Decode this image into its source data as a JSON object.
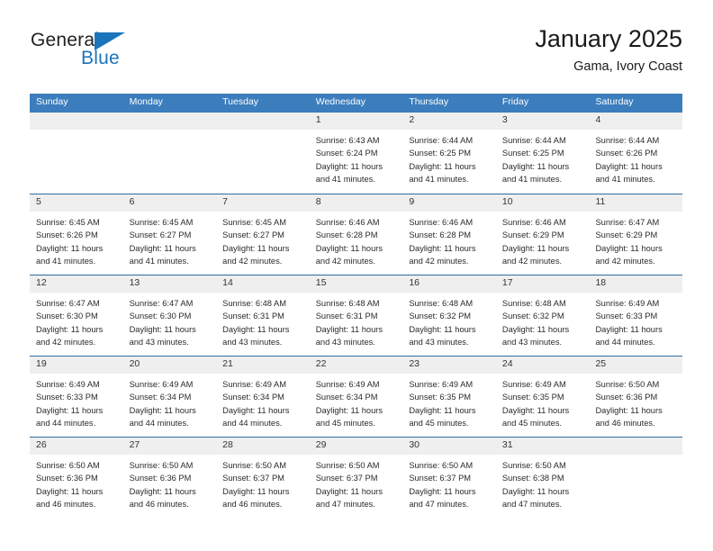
{
  "brand": {
    "name_part1": "General",
    "name_part2": "Blue",
    "colors": {
      "blue": "#1b75bb",
      "dark": "#231f20"
    }
  },
  "header": {
    "title": "January 2025",
    "subtitle": "Gama, Ivory Coast"
  },
  "calendar": {
    "accent_color": "#3b7dbd",
    "row_divider_color": "#2e6da4",
    "day_band_color": "#efefef",
    "weekday_headers": [
      "Sunday",
      "Monday",
      "Tuesday",
      "Wednesday",
      "Thursday",
      "Friday",
      "Saturday"
    ],
    "weeks": [
      [
        {
          "day": "",
          "empty": true
        },
        {
          "day": "",
          "empty": true
        },
        {
          "day": "",
          "empty": true
        },
        {
          "day": "1",
          "sunrise": "Sunrise: 6:43 AM",
          "sunset": "Sunset: 6:24 PM",
          "daylight": "Daylight: 11 hours and 41 minutes."
        },
        {
          "day": "2",
          "sunrise": "Sunrise: 6:44 AM",
          "sunset": "Sunset: 6:25 PM",
          "daylight": "Daylight: 11 hours and 41 minutes."
        },
        {
          "day": "3",
          "sunrise": "Sunrise: 6:44 AM",
          "sunset": "Sunset: 6:25 PM",
          "daylight": "Daylight: 11 hours and 41 minutes."
        },
        {
          "day": "4",
          "sunrise": "Sunrise: 6:44 AM",
          "sunset": "Sunset: 6:26 PM",
          "daylight": "Daylight: 11 hours and 41 minutes."
        }
      ],
      [
        {
          "day": "5",
          "sunrise": "Sunrise: 6:45 AM",
          "sunset": "Sunset: 6:26 PM",
          "daylight": "Daylight: 11 hours and 41 minutes."
        },
        {
          "day": "6",
          "sunrise": "Sunrise: 6:45 AM",
          "sunset": "Sunset: 6:27 PM",
          "daylight": "Daylight: 11 hours and 41 minutes."
        },
        {
          "day": "7",
          "sunrise": "Sunrise: 6:45 AM",
          "sunset": "Sunset: 6:27 PM",
          "daylight": "Daylight: 11 hours and 42 minutes."
        },
        {
          "day": "8",
          "sunrise": "Sunrise: 6:46 AM",
          "sunset": "Sunset: 6:28 PM",
          "daylight": "Daylight: 11 hours and 42 minutes."
        },
        {
          "day": "9",
          "sunrise": "Sunrise: 6:46 AM",
          "sunset": "Sunset: 6:28 PM",
          "daylight": "Daylight: 11 hours and 42 minutes."
        },
        {
          "day": "10",
          "sunrise": "Sunrise: 6:46 AM",
          "sunset": "Sunset: 6:29 PM",
          "daylight": "Daylight: 11 hours and 42 minutes."
        },
        {
          "day": "11",
          "sunrise": "Sunrise: 6:47 AM",
          "sunset": "Sunset: 6:29 PM",
          "daylight": "Daylight: 11 hours and 42 minutes."
        }
      ],
      [
        {
          "day": "12",
          "sunrise": "Sunrise: 6:47 AM",
          "sunset": "Sunset: 6:30 PM",
          "daylight": "Daylight: 11 hours and 42 minutes."
        },
        {
          "day": "13",
          "sunrise": "Sunrise: 6:47 AM",
          "sunset": "Sunset: 6:30 PM",
          "daylight": "Daylight: 11 hours and 43 minutes."
        },
        {
          "day": "14",
          "sunrise": "Sunrise: 6:48 AM",
          "sunset": "Sunset: 6:31 PM",
          "daylight": "Daylight: 11 hours and 43 minutes."
        },
        {
          "day": "15",
          "sunrise": "Sunrise: 6:48 AM",
          "sunset": "Sunset: 6:31 PM",
          "daylight": "Daylight: 11 hours and 43 minutes."
        },
        {
          "day": "16",
          "sunrise": "Sunrise: 6:48 AM",
          "sunset": "Sunset: 6:32 PM",
          "daylight": "Daylight: 11 hours and 43 minutes."
        },
        {
          "day": "17",
          "sunrise": "Sunrise: 6:48 AM",
          "sunset": "Sunset: 6:32 PM",
          "daylight": "Daylight: 11 hours and 43 minutes."
        },
        {
          "day": "18",
          "sunrise": "Sunrise: 6:49 AM",
          "sunset": "Sunset: 6:33 PM",
          "daylight": "Daylight: 11 hours and 44 minutes."
        }
      ],
      [
        {
          "day": "19",
          "sunrise": "Sunrise: 6:49 AM",
          "sunset": "Sunset: 6:33 PM",
          "daylight": "Daylight: 11 hours and 44 minutes."
        },
        {
          "day": "20",
          "sunrise": "Sunrise: 6:49 AM",
          "sunset": "Sunset: 6:34 PM",
          "daylight": "Daylight: 11 hours and 44 minutes."
        },
        {
          "day": "21",
          "sunrise": "Sunrise: 6:49 AM",
          "sunset": "Sunset: 6:34 PM",
          "daylight": "Daylight: 11 hours and 44 minutes."
        },
        {
          "day": "22",
          "sunrise": "Sunrise: 6:49 AM",
          "sunset": "Sunset: 6:34 PM",
          "daylight": "Daylight: 11 hours and 45 minutes."
        },
        {
          "day": "23",
          "sunrise": "Sunrise: 6:49 AM",
          "sunset": "Sunset: 6:35 PM",
          "daylight": "Daylight: 11 hours and 45 minutes."
        },
        {
          "day": "24",
          "sunrise": "Sunrise: 6:49 AM",
          "sunset": "Sunset: 6:35 PM",
          "daylight": "Daylight: 11 hours and 45 minutes."
        },
        {
          "day": "25",
          "sunrise": "Sunrise: 6:50 AM",
          "sunset": "Sunset: 6:36 PM",
          "daylight": "Daylight: 11 hours and 46 minutes."
        }
      ],
      [
        {
          "day": "26",
          "sunrise": "Sunrise: 6:50 AM",
          "sunset": "Sunset: 6:36 PM",
          "daylight": "Daylight: 11 hours and 46 minutes."
        },
        {
          "day": "27",
          "sunrise": "Sunrise: 6:50 AM",
          "sunset": "Sunset: 6:36 PM",
          "daylight": "Daylight: 11 hours and 46 minutes."
        },
        {
          "day": "28",
          "sunrise": "Sunrise: 6:50 AM",
          "sunset": "Sunset: 6:37 PM",
          "daylight": "Daylight: 11 hours and 46 minutes."
        },
        {
          "day": "29",
          "sunrise": "Sunrise: 6:50 AM",
          "sunset": "Sunset: 6:37 PM",
          "daylight": "Daylight: 11 hours and 47 minutes."
        },
        {
          "day": "30",
          "sunrise": "Sunrise: 6:50 AM",
          "sunset": "Sunset: 6:37 PM",
          "daylight": "Daylight: 11 hours and 47 minutes."
        },
        {
          "day": "31",
          "sunrise": "Sunrise: 6:50 AM",
          "sunset": "Sunset: 6:38 PM",
          "daylight": "Daylight: 11 hours and 47 minutes."
        },
        {
          "day": "",
          "empty": true
        }
      ]
    ]
  }
}
